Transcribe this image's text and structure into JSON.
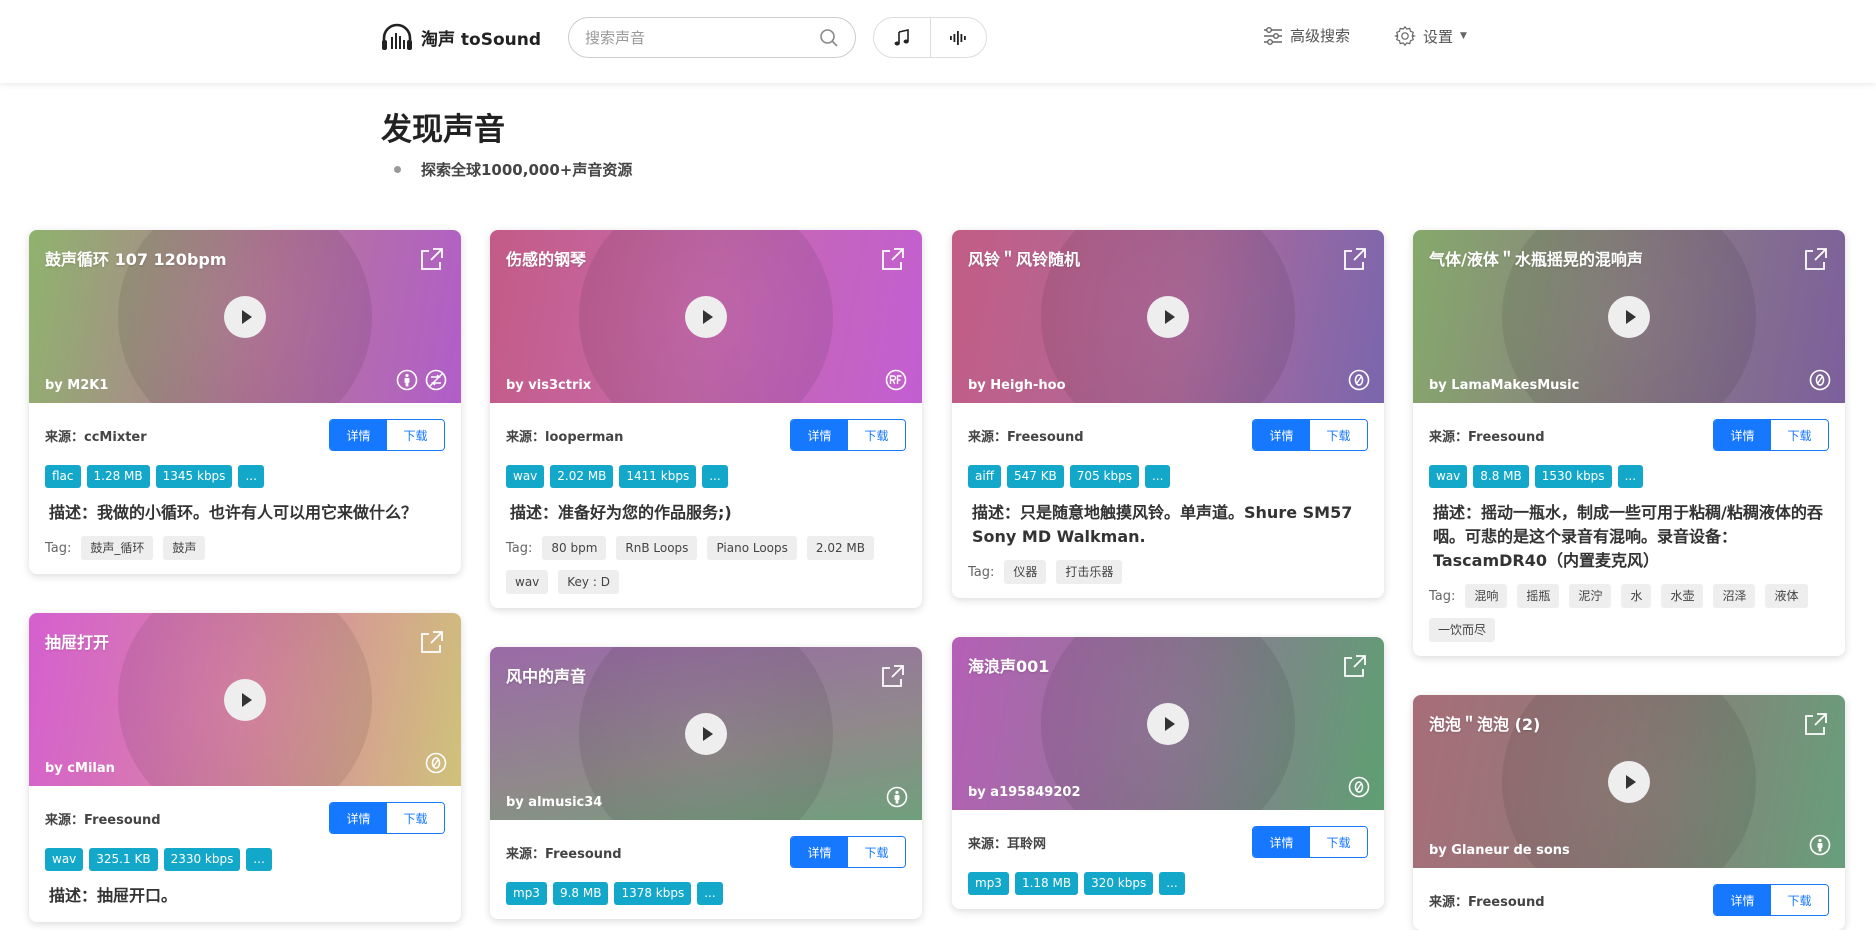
{
  "header": {
    "brand": "淘声 toSound",
    "search_placeholder": "搜索声音",
    "advanced_search": "高级搜索",
    "settings": "设置"
  },
  "page": {
    "title": "发现声音",
    "subtitle": "探索全球1000,000+声音资源"
  },
  "labels": {
    "source_prefix": "来源：",
    "detail": "详情",
    "download": "下载",
    "desc_prefix": "描述：",
    "tag_prefix": "Tag:",
    "more": "..."
  },
  "cards": [
    {
      "title": "鼓声循环 107 120bpm",
      "author": "by M2K1",
      "source": "ccMixter",
      "format": "flac",
      "size": "1.28 MB",
      "bitrate": "1345 kbps",
      "description": "我做的小循环。也许有人可以用它来做什么？",
      "tags": [
        "鼓声_循环",
        "鼓声"
      ],
      "licenses": [
        "person-icon",
        "no-derivatives-icon"
      ],
      "gradient": "linear-gradient(100deg,#8fb36d 0%,#b6769a 55%,#b05ec9 100%)"
    },
    {
      "title": "抽屉打开",
      "author": "by cMilan",
      "source": "Freesound",
      "format": "wav",
      "size": "325.1 KB",
      "bitrate": "2330 kbps",
      "description": "抽屉开口。",
      "tags": [],
      "licenses": [
        "zero-icon"
      ],
      "gradient": "linear-gradient(100deg,#d55fcf 0%,#d98aa0 55%,#cfc27a 100%)"
    },
    {
      "title": "伤感的钢琴",
      "author": "by vis3ctrix",
      "source": "looperman",
      "format": "wav",
      "size": "2.02 MB",
      "bitrate": "1411 kbps",
      "description": "准备好为您的作品服务;)",
      "tags": [
        "80 bpm",
        "RnB Loops",
        "Piano Loops",
        "2.02 MB",
        "wav",
        "Key : D"
      ],
      "licenses": [
        "rf-icon"
      ],
      "gradient": "linear-gradient(100deg,#c45b86 0%,#c66aad 50%,#c35ed2 100%)"
    },
    {
      "title": "风中的声音",
      "author": "by almusic34",
      "source": "Freesound",
      "format": "mp3",
      "size": "9.8 MB",
      "bitrate": "1378 kbps",
      "description": "",
      "tags": [],
      "licenses": [
        "person-icon"
      ],
      "gradient": "linear-gradient(170deg,#9b6aa8 0%,#8f8a8a 60%,#6fa07c 100%)"
    },
    {
      "title": "风铃＂风铃随机",
      "author": "by Heigh-hoo",
      "source": "Freesound",
      "format": "aiff",
      "size": "547 KB",
      "bitrate": "705 kbps",
      "description": "只是随意地触摸风铃。单声道。Shure SM57 Sony MD Walkman.",
      "tags": [
        "仪器",
        "打击乐器"
      ],
      "licenses": [
        "zero-icon"
      ],
      "gradient": "linear-gradient(100deg,#c25d86 0%,#ad6a9b 55%,#7a66ad 100%)"
    },
    {
      "title": "海浪声001",
      "author": "by a195849202",
      "source": "耳聆网",
      "format": "mp3",
      "size": "1.18 MB",
      "bitrate": "320 kbps",
      "description": "",
      "tags": [],
      "licenses": [
        "zero-icon"
      ],
      "gradient": "linear-gradient(100deg,#b55fb6 0%,#8c7c93 55%,#5e9f72 100%)"
    },
    {
      "title": "气体/液体＂水瓶摇晃的混响声",
      "author": "by LamaMakesMusic",
      "source": "Freesound",
      "format": "wav",
      "size": "8.8 MB",
      "bitrate": "1530 kbps",
      "description": "摇动一瓶水，制成一些可用于粘稠/粘稠液体的吞咽。可悲的是这个录音有混响。录音设备：TascamDR40（内置麦克风）",
      "tags": [
        "混响",
        "摇瓶",
        "泥泞",
        "水",
        "水壶",
        "沼泽",
        "液体",
        "一饮而尽"
      ],
      "licenses": [
        "zero-icon"
      ],
      "gradient": "linear-gradient(100deg,#86a96b 0%,#8a7a85 55%,#7c5f9c 100%)"
    },
    {
      "title": "泡泡＂泡泡 (2)",
      "author": "by Glaneur de sons",
      "source": "Freesound",
      "format": "",
      "size": "",
      "bitrate": "",
      "description": "",
      "tags": [],
      "licenses": [
        "person-icon"
      ],
      "gradient": "linear-gradient(100deg,#a86d79 0%,#8a7e78 55%,#679f7b 100%)"
    }
  ]
}
